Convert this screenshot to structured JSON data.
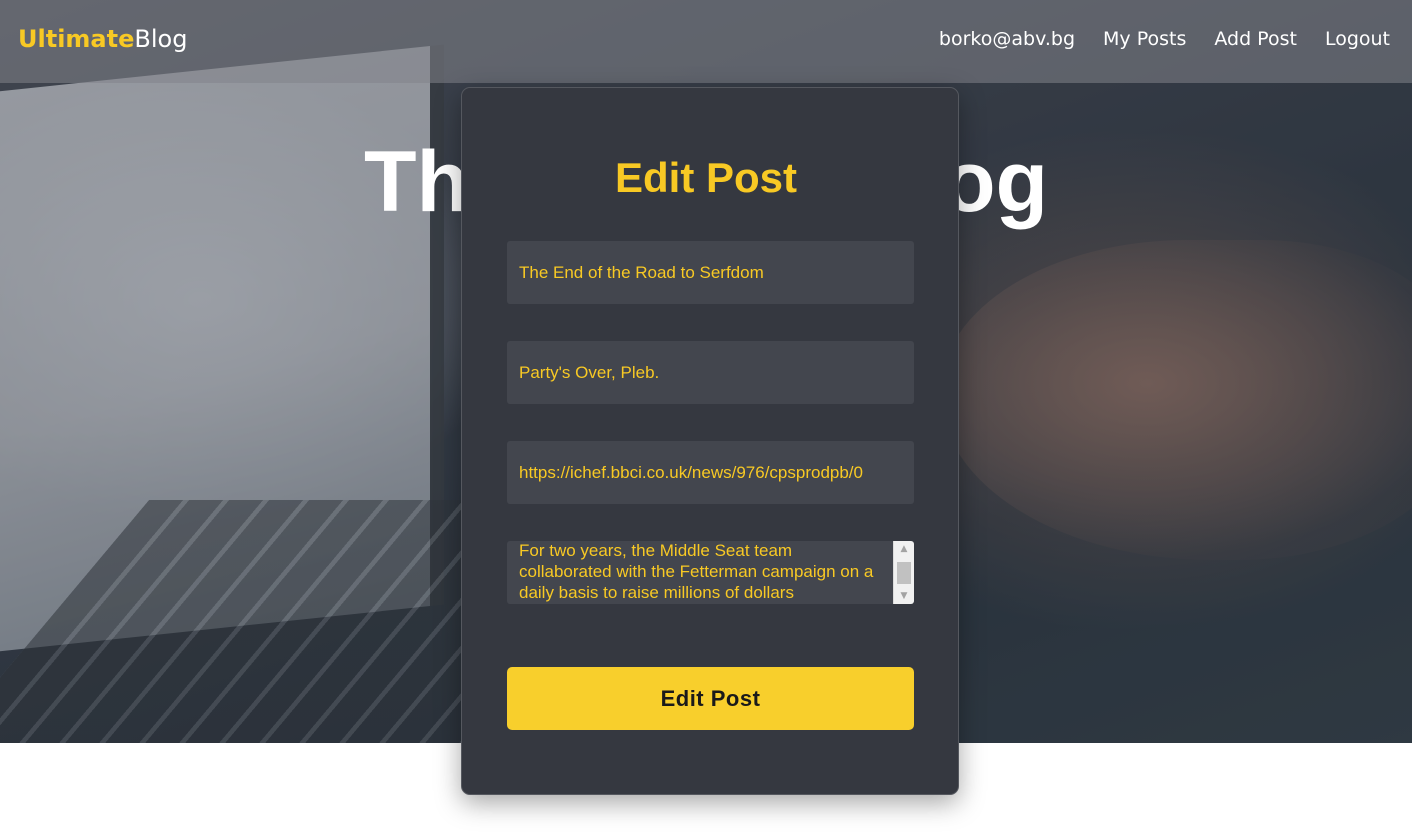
{
  "navbar": {
    "logo_part1": "Ultimate",
    "logo_part2": "Blog",
    "links": [
      {
        "label": "borko@abv.bg"
      },
      {
        "label": "My Posts"
      },
      {
        "label": "Add Post"
      },
      {
        "label": "Logout"
      }
    ]
  },
  "hero": {
    "title_left": "Th",
    "title_right": "log"
  },
  "form": {
    "title": "Edit Post",
    "title_value": "The End of the Road to Serfdom",
    "description_value": "Party's Over, Pleb.",
    "image_url_value": "https://ichef.bbci.co.uk/news/976/cpsprodpb/0",
    "content_value": "For two years, the Middle Seat team collaborated with the Fetterman campaign on a daily basis to raise millions of dollars",
    "submit_label": "Edit Post"
  },
  "colors": {
    "accent": "#f8c924",
    "card_bg": "#353840",
    "field_bg": "#43464e"
  }
}
